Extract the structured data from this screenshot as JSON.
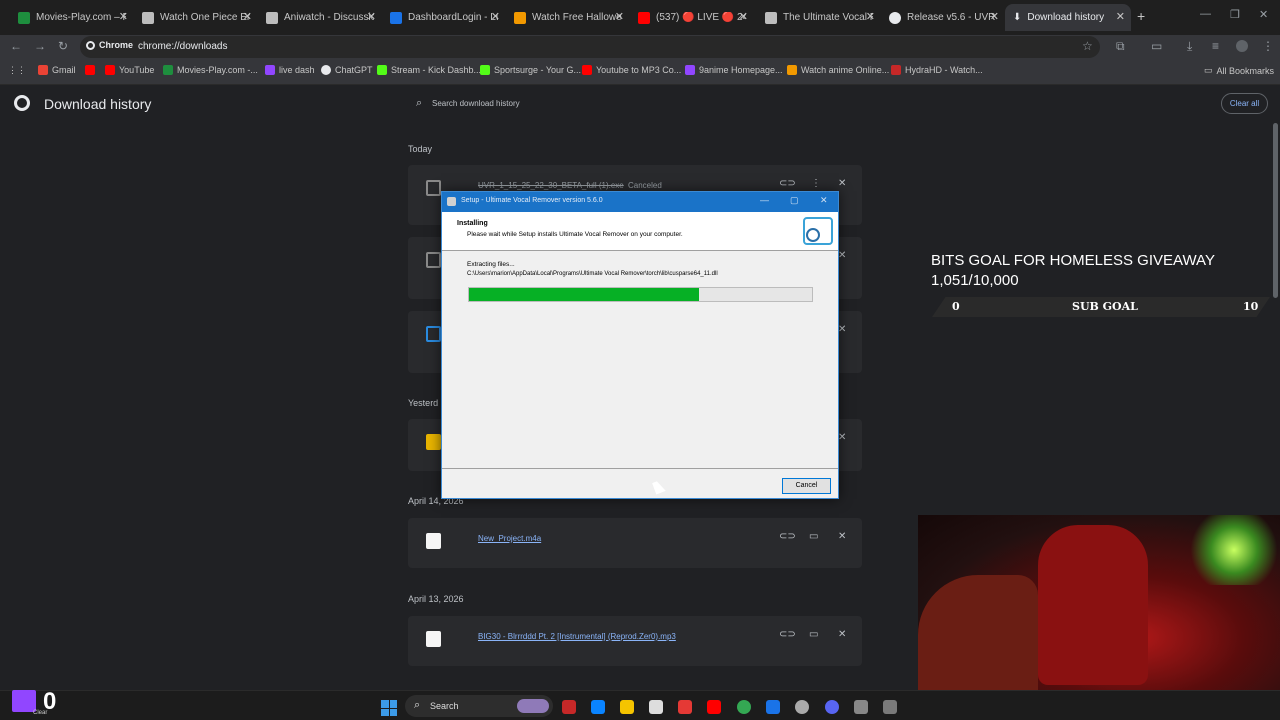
{
  "tabs": [
    {
      "title": "Movies-Play.com – Re",
      "color": "#1e8e3e"
    },
    {
      "title": "Watch One Piece Eng",
      "color": "#bdbdbd"
    },
    {
      "title": "Aniwatch - Discussion",
      "color": "#bdbdbd"
    },
    {
      "title": "DashboardLogin - Lu",
      "color": "#1a73e8"
    },
    {
      "title": "Watch Free Halloween",
      "color": "#f29900"
    },
    {
      "title": "(537) 🔴 LIVE 🔴 24H",
      "color": "#ff0000"
    },
    {
      "title": "The Ultimate Vocal Re",
      "color": "#bdbdbd"
    },
    {
      "title": "Release v5.6 - UVR GI",
      "color": "#e8eaed"
    },
    {
      "title": "Download history",
      "color": "#e8eaed"
    }
  ],
  "omnibox": {
    "chip": "Chrome",
    "url": "chrome://downloads"
  },
  "bookmarks": [
    {
      "label": "Gmail",
      "color": "#ea4335"
    },
    {
      "label": "YouTube",
      "color": "#ff0000"
    },
    {
      "label": "Movies-Play.com -...",
      "color": "#1e8e3e"
    },
    {
      "label": "live dash",
      "color": "#9146ff"
    },
    {
      "label": "ChatGPT",
      "color": "#e8eaed"
    },
    {
      "label": "Stream - Kick Dashb...",
      "color": "#53fc18"
    },
    {
      "label": "Sportsurge - Your G...",
      "color": "#53fc18"
    },
    {
      "label": "Youtube to MP3 Co...",
      "color": "#ff0000"
    },
    {
      "label": "9anime Homepage...",
      "color": "#9146ff"
    },
    {
      "label": "Watch anime Online...",
      "color": "#f29900"
    },
    {
      "label": "HydraHD - Watch...",
      "color": "#c62828"
    }
  ],
  "all_bookmarks": "All Bookmarks",
  "downloads": {
    "title": "Download history",
    "search_placeholder": "Search download history",
    "clear_all": "Clear all",
    "groups": [
      {
        "date": "Today"
      },
      {
        "date": "Yesterd"
      },
      {
        "date": "April 14, 2026"
      },
      {
        "date": "April 13, 2026"
      }
    ],
    "items": [
      {
        "name": "UVR_1_15_25_22_30_BETA_full (1).exe",
        "status": "Canceled"
      },
      {
        "name": "New_Project.m4a",
        "status": ""
      },
      {
        "name": "BIG30 - Blrrrddd Pt. 2 [Instrumental] (Reprod.Zer0).mp3",
        "status": ""
      }
    ]
  },
  "dialog": {
    "title": "Setup - Ultimate Vocal Remover version 5.6.0",
    "heading": "Installing",
    "subheading": "Please wait while Setup installs Ultimate Vocal Remover on your computer.",
    "extracting": "Extracting files...",
    "path": "C:\\Users\\marion\\AppData\\Local\\Programs\\Ultimate Vocal Remover\\torch\\lib\\cusparse64_11.dll",
    "progress": 0.67,
    "cancel": "Cancel"
  },
  "overlay": {
    "bits_title": "BITS GOAL FOR HOMELESS GIVEAWAY",
    "bits_count": "1,051/10,000",
    "sub_goal_label": "SUB GOAL",
    "sub_goal_min": "0",
    "sub_goal_max": "10",
    "twitch_count": "0",
    "twitch_clear": "Clear"
  },
  "taskbar": {
    "search": "Search"
  }
}
